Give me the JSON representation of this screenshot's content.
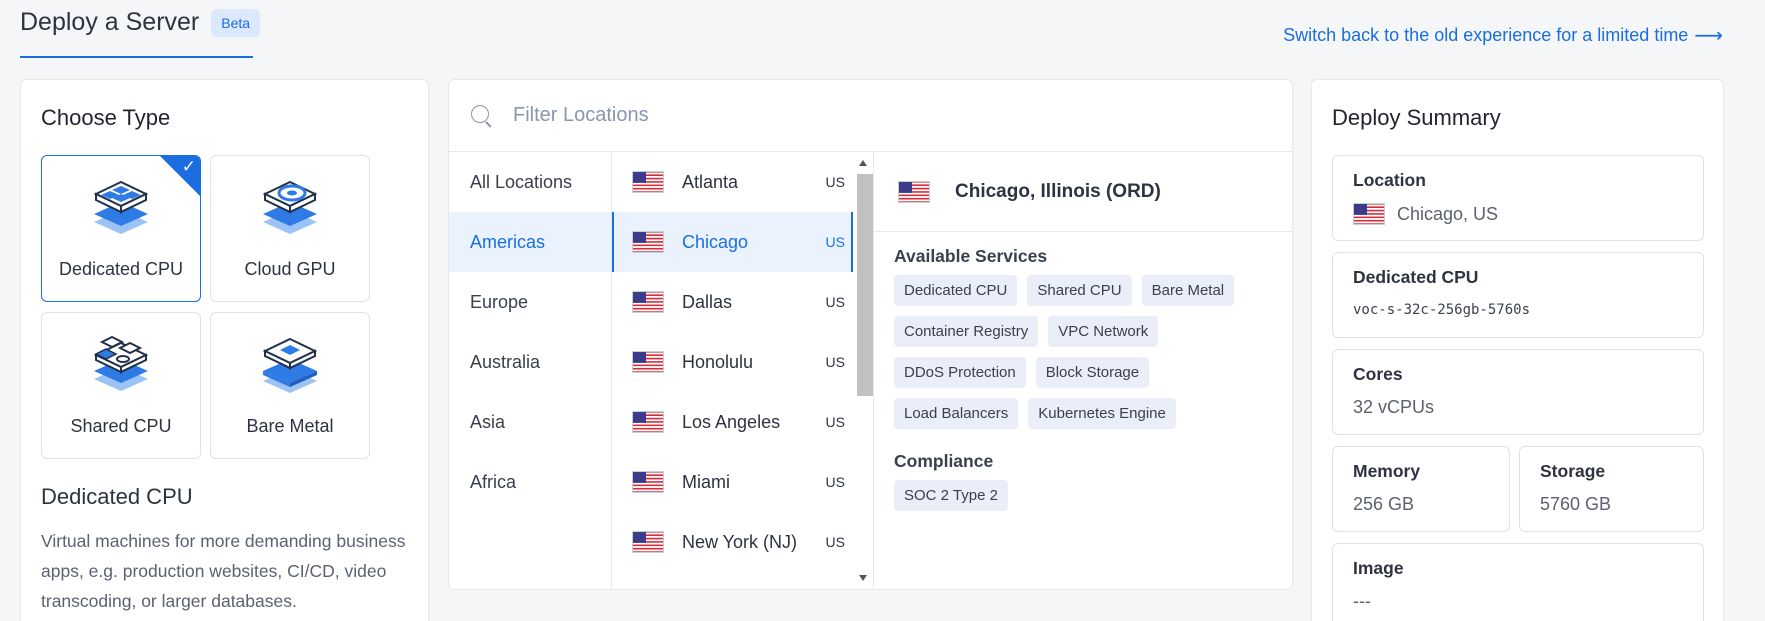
{
  "header": {
    "title": "Deploy a Server",
    "badge": "Beta",
    "switch_link": "Switch back to the old experience for a limited time",
    "switch_arrow": "⟶"
  },
  "colors": {
    "accent": "#1a6ee0",
    "selected_bg": "#eaf2fd",
    "tag_bg": "#eaeef8"
  },
  "choose_type": {
    "heading": "Choose Type",
    "tiles": [
      {
        "label": "Dedicated CPU",
        "icon": "dedicated-cpu-icon",
        "selected": true
      },
      {
        "label": "Cloud GPU",
        "icon": "cloud-gpu-icon",
        "selected": false
      },
      {
        "label": "Shared CPU",
        "icon": "shared-cpu-icon",
        "selected": false
      },
      {
        "label": "Bare Metal",
        "icon": "bare-metal-icon",
        "selected": false
      }
    ],
    "description_title": "Dedicated CPU",
    "description": "Virtual machines for more demanding business apps, e.g. production websites, CI/CD, video transcoding, or larger databases."
  },
  "locations": {
    "search_placeholder": "Filter Locations",
    "regions": [
      {
        "label": "All Locations",
        "active": false
      },
      {
        "label": "Americas",
        "active": true
      },
      {
        "label": "Europe",
        "active": false
      },
      {
        "label": "Australia",
        "active": false
      },
      {
        "label": "Asia",
        "active": false
      },
      {
        "label": "Africa",
        "active": false
      }
    ],
    "cities": [
      {
        "name": "Atlanta",
        "code": "US",
        "active": false
      },
      {
        "name": "Chicago",
        "code": "US",
        "active": true
      },
      {
        "name": "Dallas",
        "code": "US",
        "active": false
      },
      {
        "name": "Honolulu",
        "code": "US",
        "active": false
      },
      {
        "name": "Los Angeles",
        "code": "US",
        "active": false
      },
      {
        "name": "Miami",
        "code": "US",
        "active": false
      },
      {
        "name": "New York (NJ)",
        "code": "US",
        "active": false
      }
    ],
    "selected": {
      "name": "Chicago, Illinois (ORD)",
      "services_title": "Available Services",
      "services": [
        "Dedicated CPU",
        "Shared CPU",
        "Bare Metal",
        "Container Registry",
        "VPC Network",
        "DDoS Protection",
        "Block Storage",
        "Load Balancers",
        "Kubernetes Engine"
      ],
      "compliance_title": "Compliance",
      "compliance": [
        "SOC 2 Type 2"
      ]
    }
  },
  "summary": {
    "heading": "Deploy Summary",
    "location_label": "Location",
    "location_value": "Chicago, US",
    "plan_label": "Dedicated CPU",
    "plan_value": "voc-s-32c-256gb-5760s",
    "cores_label": "Cores",
    "cores_value": "32 vCPUs",
    "memory_label": "Memory",
    "memory_value": "256 GB",
    "storage_label": "Storage",
    "storage_value": "5760 GB",
    "image_label": "Image",
    "image_value": "---"
  }
}
